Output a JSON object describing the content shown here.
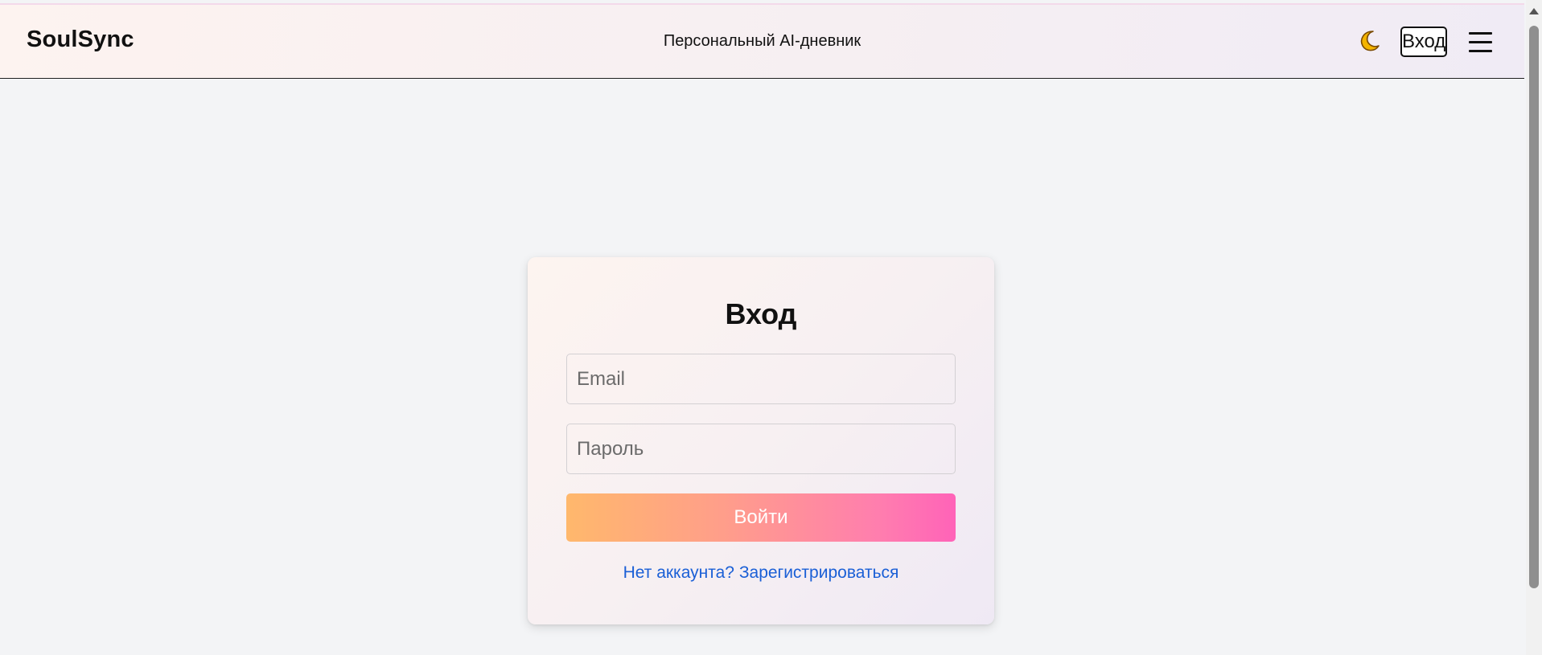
{
  "header": {
    "logo": "SoulSync",
    "subtitle": "Персональный AI-дневник",
    "theme_toggle_icon": "moon-icon",
    "login_label": "Вход",
    "menu_icon": "hamburger-menu-icon"
  },
  "login_card": {
    "title": "Вход",
    "email_placeholder": "Email",
    "email_value": "",
    "password_placeholder": "Пароль",
    "password_value": "",
    "submit_label": "Войти",
    "register_link": "Нет аккаунта? Зарегистрироваться"
  },
  "colors": {
    "page_background": "#f3f4f6",
    "button_gradient_start": "#ffb86c",
    "button_gradient_end": "#ff63b8",
    "link": "#1a5fd6",
    "moon": "#f4b400"
  }
}
